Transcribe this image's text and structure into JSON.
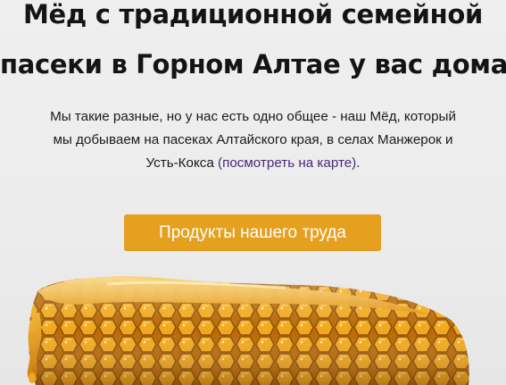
{
  "hero": {
    "title_line1": "Мёд с традиционной семейной",
    "title_line2": "пасеки в Горном Алтае у вас дома.",
    "lead_line1": "Мы такие разные, но у нас есть одно общее - наш Мёд, который",
    "lead_line2": "мы добываем на пасеках Алтайского края, в селах Манжерок и",
    "lead_line3_prefix": "Усть-Кокса ",
    "map_link": "(посмотреть на карте)",
    "lead_line3_suffix": ".",
    "cta_label": "Продукты нашего труда"
  },
  "colors": {
    "background": "#ececec",
    "cta_background": "#e5a01f",
    "cta_text": "#ffffff",
    "link": "#4a2a7a",
    "honey": "#e89a12"
  },
  "image": {
    "icon": "honeycomb-image"
  }
}
